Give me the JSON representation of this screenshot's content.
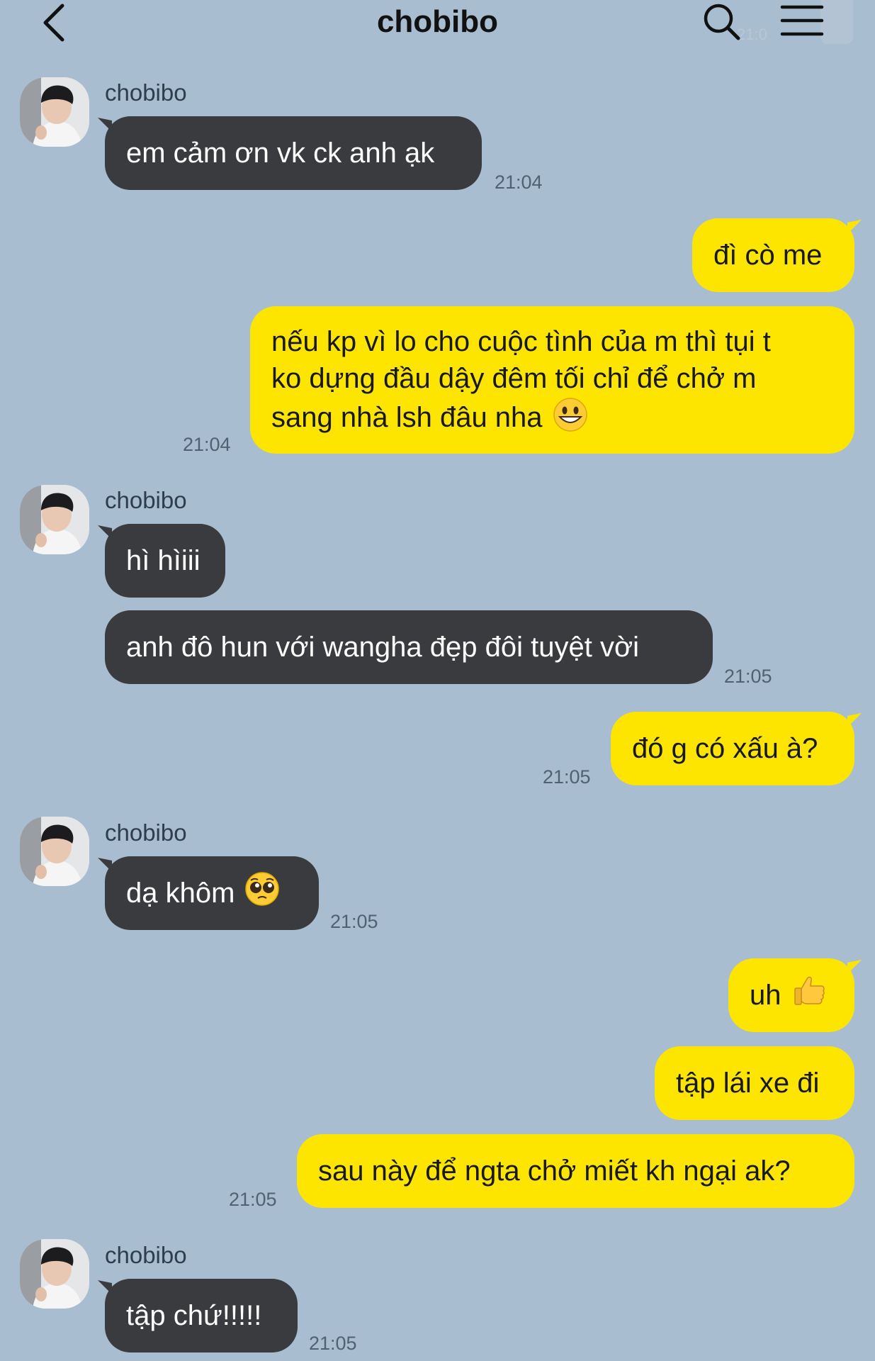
{
  "header": {
    "title": "chobibo",
    "faint_time": "21:0"
  },
  "messages": [
    {
      "sender": "chobibo",
      "text": "em cảm ơn vk ck anh ạk",
      "time": "21:04"
    },
    {
      "text": "đì cò me"
    },
    {
      "lines": [
        "nếu kp vì lo cho cuộc tình của m thì tụi t",
        "ko dựng đầu dậy đêm tối chỉ để chở m",
        "sang nhà lsh đâu nha"
      ],
      "time": "21:04",
      "emoji": "grinning-face-emoji"
    },
    {
      "sender": "chobibo",
      "text": "hì hìiii"
    },
    {
      "text": "anh đô hun với wangha đẹp đôi tuyệt vời",
      "time": "21:05"
    },
    {
      "text": "đó g có xấu à?",
      "time": "21:05"
    },
    {
      "sender": "chobibo",
      "text": "dạ khôm",
      "time": "21:05",
      "emoji": "pleading-face-emoji"
    },
    {
      "text": "uh",
      "emoji": "thumbs-up-emoji"
    },
    {
      "text": "tập lái xe đi"
    },
    {
      "text": "sau này để ngta chở miết kh ngại ak?",
      "time": "21:05"
    },
    {
      "sender": "chobibo",
      "text": "tập chứ!!!!!",
      "time": "21:05"
    }
  ],
  "colors": {
    "background": "#a9bdd0",
    "incoming_bubble": "#3a3b3e",
    "outgoing_bubble": "#fee500"
  }
}
